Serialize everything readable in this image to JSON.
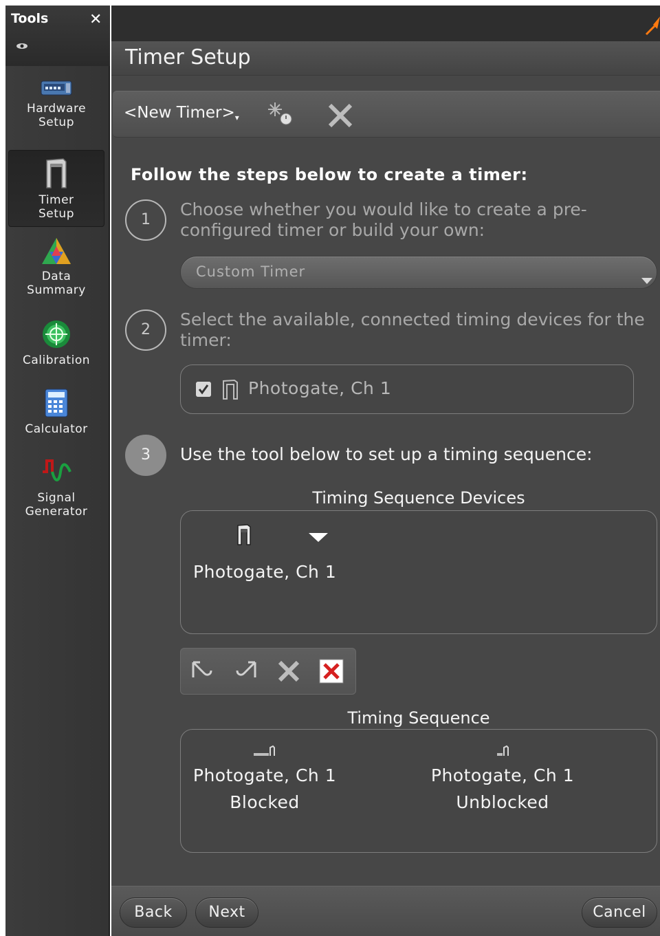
{
  "sidebar": {
    "title": "Tools",
    "close_icon": "close-icon",
    "items": [
      {
        "label": "Hardware Setup",
        "lines": [
          "Hardware",
          "Setup"
        ],
        "icon": "hardware-setup-icon"
      },
      {
        "label": "Timer Setup",
        "lines": [
          "Timer",
          "Setup"
        ],
        "icon": "timer-gate-icon",
        "active": true
      },
      {
        "label": "Data Summary",
        "lines": [
          "Data",
          "Summary"
        ],
        "icon": "data-summary-icon"
      },
      {
        "label": "Calibration",
        "lines": [
          "Calibration"
        ],
        "icon": "calibration-icon"
      },
      {
        "label": "Calculator",
        "lines": [
          "Calculator"
        ],
        "icon": "calculator-icon"
      },
      {
        "label": "Signal Generator",
        "lines": [
          "Signal",
          "Generator"
        ],
        "icon": "signal-generator-icon"
      }
    ]
  },
  "main": {
    "title": "Timer Setup",
    "timer_select": "<New Timer>",
    "instructions": "Follow the steps below to create a timer:",
    "steps": [
      {
        "number": "1",
        "lines": [
          "Choose whether you would like to create a pre-",
          "configured timer or build your own:"
        ]
      },
      {
        "number": "2",
        "lines": [
          "Select the available, connected timing devices for the",
          "timer:"
        ]
      },
      {
        "number": "3",
        "lines": [
          "Use the tool below to set up a timing sequence:"
        ]
      }
    ],
    "timer_type": "Custom Timer",
    "device": {
      "label": "Photogate, Ch 1",
      "checked": true
    },
    "sequence_devices_title": "Timing Sequence Devices",
    "sequence_device_name": "Photogate, Ch 1",
    "timing_sequence_title": "Timing Sequence",
    "timing_sequence": [
      {
        "name": "Photogate, Ch 1",
        "state": "Blocked"
      },
      {
        "name": "Photogate, Ch 1",
        "state": "Unblocked"
      }
    ]
  },
  "footer": {
    "back": "Back",
    "next": "Next",
    "cancel": "Cancel"
  },
  "colors": {
    "panel_bg": "#474747",
    "sidebar_bg": "#3a3a3a",
    "text": "#f4f4f4",
    "dim_text": "#a9a9a9",
    "pin_accent": "#ff6a00",
    "delete_red": "#d62020"
  }
}
